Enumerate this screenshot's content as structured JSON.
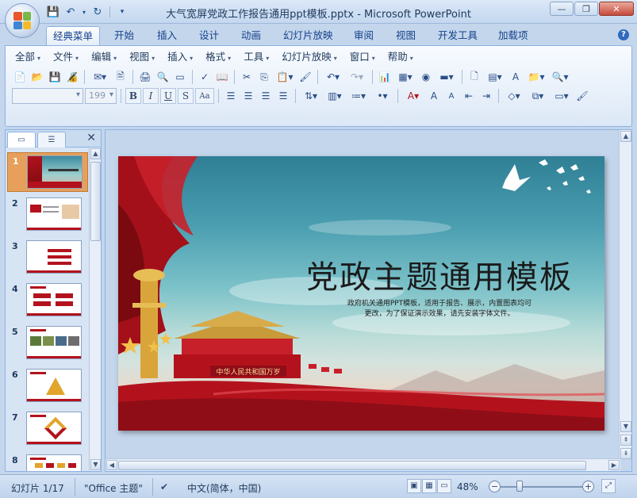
{
  "window": {
    "title": "大气宽屏党政工作报告通用ppt模板.pptx - Microsoft PowerPoint"
  },
  "ribbon_tabs": [
    {
      "label": "经典菜单",
      "active": true
    },
    {
      "label": "开始"
    },
    {
      "label": "插入"
    },
    {
      "label": "设计"
    },
    {
      "label": "动画"
    },
    {
      "label": "幻灯片放映"
    },
    {
      "label": "审阅"
    },
    {
      "label": "视图"
    },
    {
      "label": "开发工具"
    },
    {
      "label": "加载项"
    }
  ],
  "classic_menu": [
    "全部",
    "文件",
    "编辑",
    "视图",
    "插入",
    "格式",
    "工具",
    "幻灯片放映",
    "窗口",
    "帮助"
  ],
  "font_size_value": "199",
  "slides_panel": {
    "items": [
      {
        "num": "1",
        "active": true
      },
      {
        "num": "2"
      },
      {
        "num": "3"
      },
      {
        "num": "4"
      },
      {
        "num": "5"
      },
      {
        "num": "6"
      },
      {
        "num": "7"
      },
      {
        "num": "8"
      }
    ]
  },
  "slide": {
    "title": "党政主题通用模板",
    "subtitle_line1": "政府机关通用PPT模板，适用于报告、展示，内置图表均可",
    "subtitle_line2": "更改，为了保证演示效果，请先安装字体文件。",
    "gate_sign": "中华人民共和国万岁"
  },
  "statusbar": {
    "slide_indicator": "幻灯片 1/17",
    "theme": "\"Office 主题\"",
    "language": "中文(简体，中国)",
    "zoom": "48%"
  },
  "colors": {
    "accent_red": "#b3121d",
    "active_thumb": "#e6a05c",
    "ribbon_blue": "#c4d6ec"
  }
}
